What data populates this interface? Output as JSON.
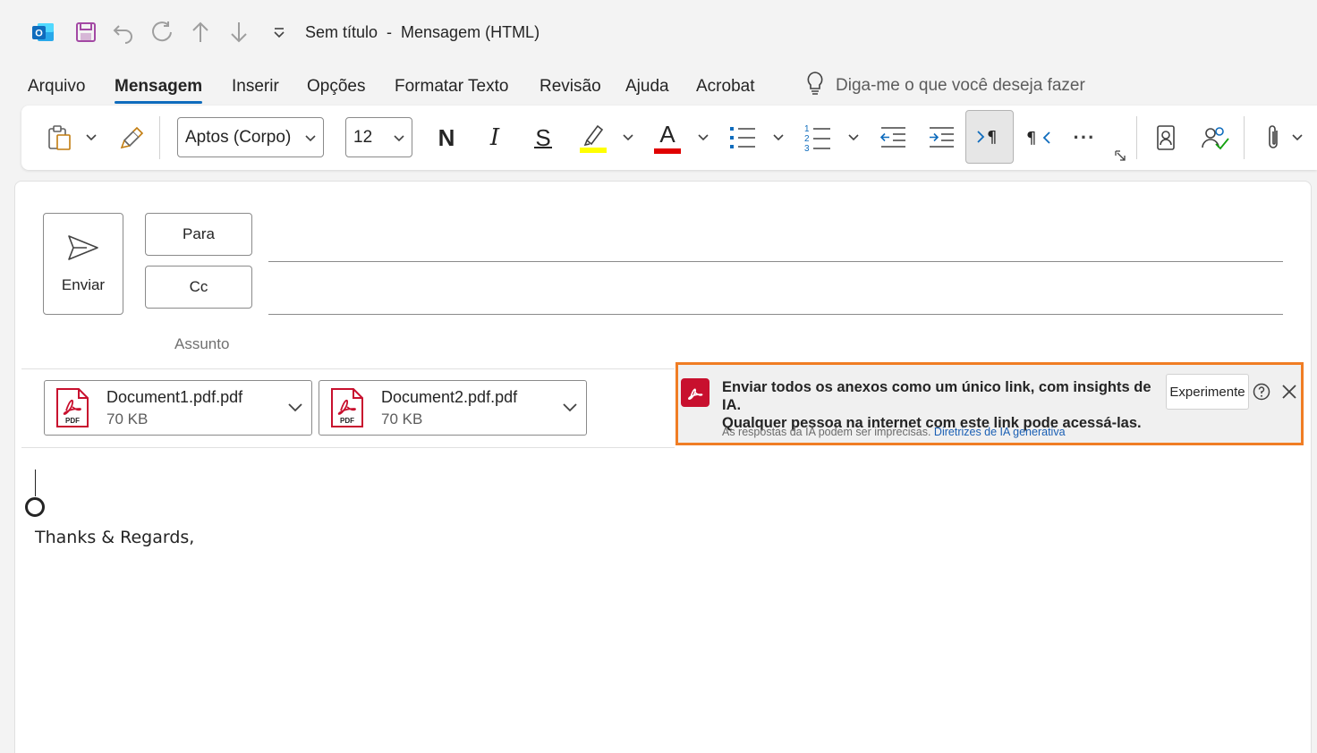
{
  "window": {
    "title": "Sem título  -  Mensagem (HTML)"
  },
  "quick_access": {
    "icons": [
      "outlook-logo-icon",
      "save-icon",
      "undo-icon",
      "redo-icon",
      "up-arrow-icon",
      "down-arrow-icon",
      "customize-qat-icon"
    ]
  },
  "ribbon_tabs": [
    {
      "label": "Arquivo",
      "active": false
    },
    {
      "label": "Mensagem",
      "active": true
    },
    {
      "label": "Inserir",
      "active": false
    },
    {
      "label": "Opções",
      "active": false
    },
    {
      "label": "Formatar Texto",
      "active": false
    },
    {
      "label": "Revisão",
      "active": false
    },
    {
      "label": "Ajuda",
      "active": false
    },
    {
      "label": "Acrobat",
      "active": false
    }
  ],
  "tell_me": {
    "placeholder": "Diga-me o que você deseja fazer"
  },
  "toolbar": {
    "font_name": "Aptos (Corpo)",
    "font_size": "12",
    "bold_glyph": "N",
    "italic_glyph": "I",
    "strike_glyph": "S",
    "font_color_glyph": "A",
    "highlight_color": "#ffff00",
    "font_color": "#e00000",
    "more_glyph": "···"
  },
  "compose": {
    "send_label": "Enviar",
    "to_label": "Para",
    "cc_label": "Cc",
    "subject_label": "Assunto"
  },
  "attachments": [
    {
      "name": "Document1.pdf.pdf",
      "size": "70 KB",
      "badge": "PDF"
    },
    {
      "name": "Document2.pdf.pdf",
      "size": "70 KB",
      "badge": "PDF"
    }
  ],
  "acrobat_banner": {
    "line1": "Enviar todos os anexos como um único link, com insights de IA.",
    "line2": "Qualquer pessoa na internet com este link pode acessá-las.",
    "try_label": "Experimente",
    "disclaimer": "As respostas da IA podem ser imprecisas.",
    "link_label": "Diretrizes de IA generativa",
    "highlight_color": "#f07d24"
  },
  "body": {
    "signature": "Thanks & Regards,"
  },
  "colors": {
    "accent": "#0f6cbd",
    "outlook_blue": "#0f6cbd",
    "save_purple": "#a349a4",
    "acrobat_red": "#c8102e"
  }
}
